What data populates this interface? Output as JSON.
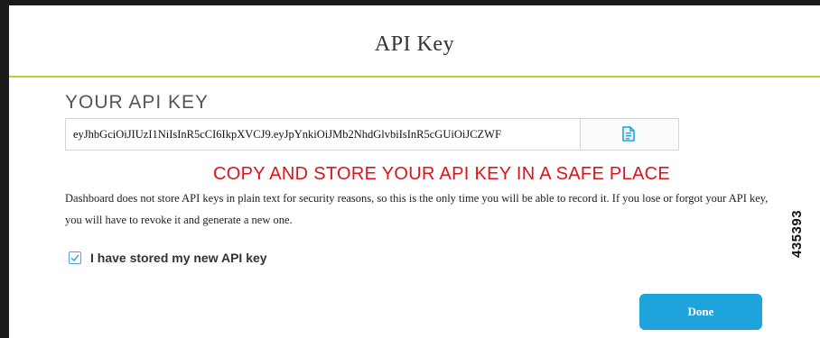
{
  "modal": {
    "title": "API Key",
    "section_heading": "YOUR API KEY",
    "api_key_value": "eyJhbGciOiJIUzI1NiIsInR5cCI6IkpXVCJ9.eyJpYnkiOiJMb2NhdGlvbiIsInR5cGUiOiJCZWF",
    "copy_icon": "copy-document-icon",
    "warning": "COPY AND STORE YOUR API KEY IN A SAFE PLACE",
    "description": "Dashboard does not store API keys in plain text for security reasons, so this is the only time you will be able to record it. If you lose or forgot your API key, you will have to revoke it and generate a new one.",
    "checkbox_label": "I have stored my new API key",
    "checkbox_checked": true,
    "done_label": "Done"
  },
  "figure_id": "435393",
  "colors": {
    "accent_divider": "#b5d334",
    "warning": "#d9161b",
    "primary_button": "#1fa3dc",
    "checkbox": "#4aa6d8"
  }
}
